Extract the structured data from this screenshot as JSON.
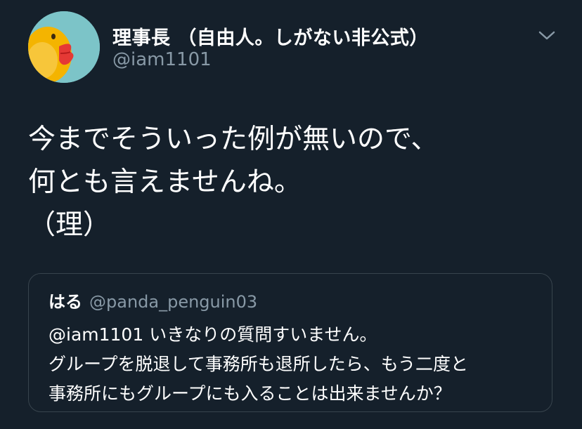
{
  "tweet": {
    "author": {
      "name": "理事長 （自由人。しがない非公式）",
      "handle": "@iam1101",
      "avatar_icon": "rubber-duck-avatar"
    },
    "menu_icon": "chevron-down-icon",
    "text_lines": [
      "今までそういった例が無いので、",
      "何とも言えませんね。",
      "（理）"
    ],
    "quoted": {
      "name": "はる",
      "handle": "@panda_penguin03",
      "text_lines": [
        "@iam1101 いきなりの質問すいません。",
        "グループを脱退して事務所も退所したら、もう二度と",
        "事務所にもグループにも入ることは出来ませんか？"
      ]
    }
  },
  "colors": {
    "background": "#15202b",
    "primary_text": "#ffffff",
    "secondary_text": "#8899a6",
    "border": "#38444d",
    "avatar_bg": "#7cc4c8",
    "duck_yellow": "#f4b400",
    "duck_beak": "#e53935"
  }
}
